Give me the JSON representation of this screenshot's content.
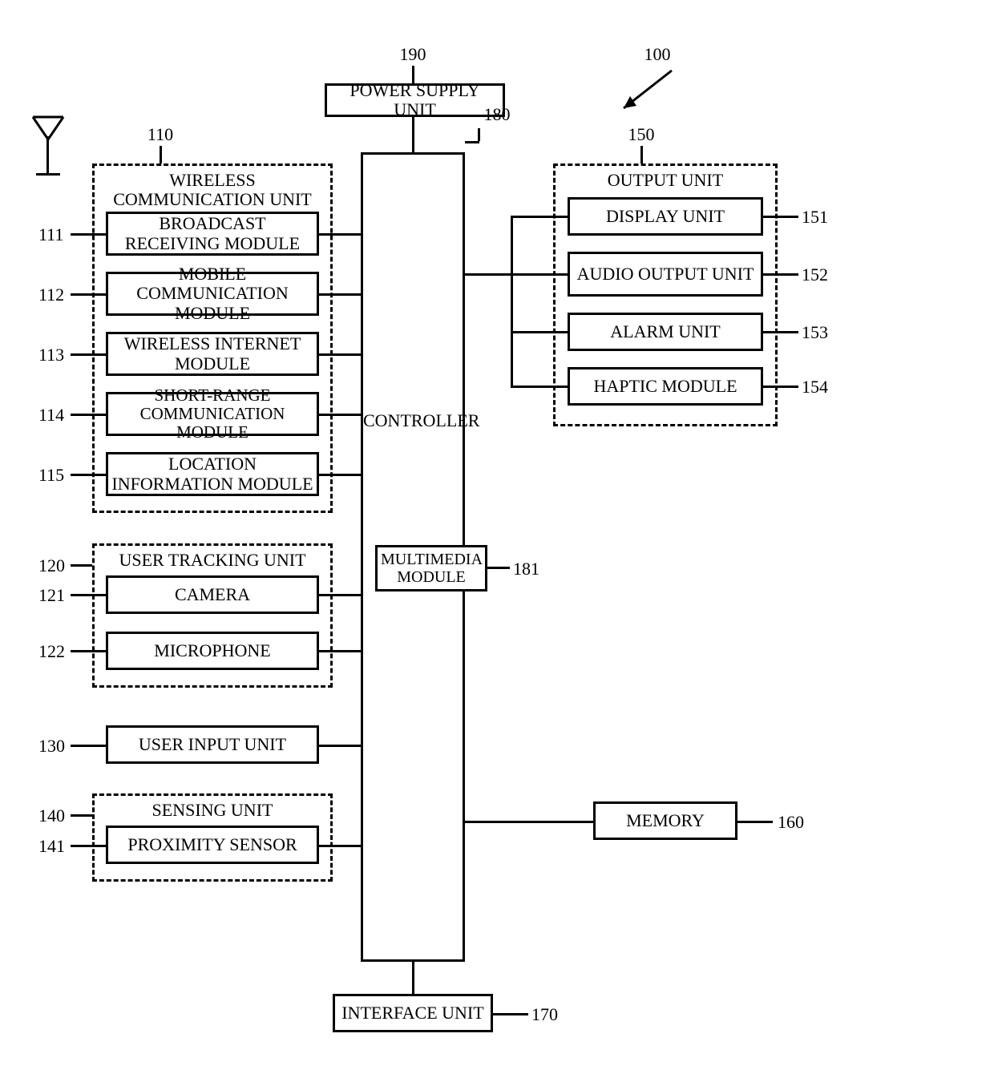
{
  "refs": {
    "device": "100",
    "wireless_unit": "110",
    "broadcast": "111",
    "mobile_comm": "112",
    "wireless_internet": "113",
    "short_range": "114",
    "location_info": "115",
    "user_tracking": "120",
    "camera": "121",
    "microphone": "122",
    "user_input": "130",
    "sensing_unit": "140",
    "proximity": "141",
    "output_unit": "150",
    "display": "151",
    "audio_output": "152",
    "alarm": "153",
    "haptic": "154",
    "memory": "160",
    "interface": "170",
    "controller": "180",
    "multimedia": "181",
    "power_supply": "190"
  },
  "labels": {
    "power_supply": "POWER SUPPLY UNIT",
    "controller": "CONTROLLER",
    "multimedia": "MULTIMEDIA MODULE",
    "wireless_unit": "WIRELESS COMMUNICATION UNIT",
    "broadcast": "BROADCAST RECEIVING MODULE",
    "mobile_comm": "MOBILE COMMUNICATION MODULE",
    "wireless_internet": "WIRELESS INTERNET MODULE",
    "short_range": "SHORT-RANGE COMMUNICATION MODULE",
    "location_info": "LOCATION INFORMATION MODULE",
    "user_tracking": "USER TRACKING UNIT",
    "camera": "CAMERA",
    "microphone": "MICROPHONE",
    "user_input": "USER INPUT UNIT",
    "sensing_unit": "SENSING UNIT",
    "proximity": "PROXIMITY SENSOR",
    "output_unit": "OUTPUT UNIT",
    "display": "DISPLAY UNIT",
    "audio_output": "AUDIO OUTPUT UNIT",
    "alarm": "ALARM UNIT",
    "haptic": "HAPTIC MODULE",
    "memory": "MEMORY",
    "interface": "INTERFACE UNIT"
  }
}
